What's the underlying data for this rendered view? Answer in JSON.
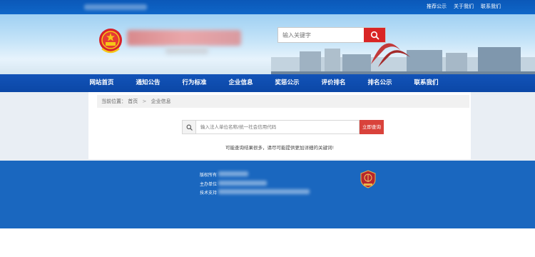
{
  "topbar": {
    "links": [
      "推荐公示",
      "关于我们",
      "联系我们"
    ]
  },
  "header": {
    "search_placeholder": "输入关键字"
  },
  "nav": {
    "items": [
      "网站首页",
      "通知公告",
      "行为标准",
      "企业信息",
      "奖惩公示",
      "评价排名",
      "排名公示",
      "联系我们"
    ]
  },
  "breadcrumb": {
    "prefix": "当前位置：",
    "home": "首页",
    "separator": ">",
    "current": "企业信息"
  },
  "query": {
    "placeholder": "输入法人单位名称/统一社会信用代码",
    "button_label": "立即查询",
    "hint": "可能查询结果很多，请尽可能提供更加详细的关键词!"
  },
  "footer": {
    "copyright_label": "版权所有",
    "host_label": "主办单位",
    "tech_label": "技术支持"
  },
  "colors": {
    "nav_blue": "#0b47a6",
    "footer_blue": "#1a67bf",
    "accent_red": "#d92525"
  }
}
